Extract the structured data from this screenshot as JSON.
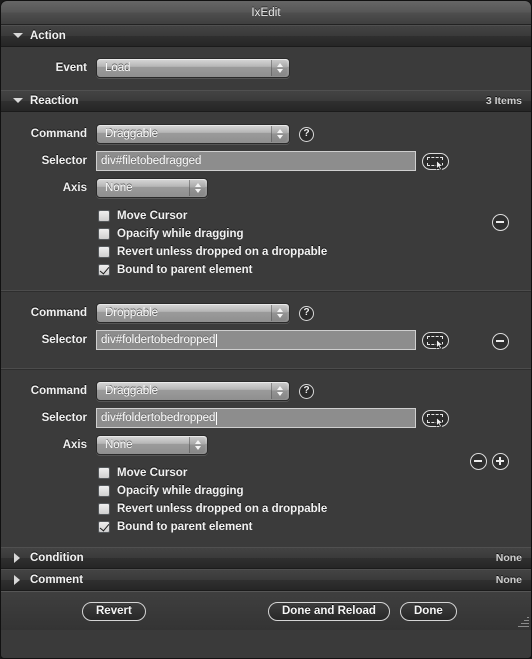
{
  "window": {
    "title": "IxEdit"
  },
  "sections": {
    "action": {
      "title": "Action",
      "disclosure": "triangle-down-icon",
      "event_label": "Event",
      "event_value": "Load"
    },
    "reaction": {
      "title": "Reaction",
      "disclosure": "triangle-down-icon",
      "count_label": "3 Items",
      "field_labels": {
        "command": "Command",
        "selector": "Selector",
        "axis": "Axis"
      },
      "help_glyph": "?",
      "items": [
        {
          "command": "Draggable",
          "selector": "div#filetobedragged",
          "selector_has_caret": false,
          "axis": "None",
          "has_axis": true,
          "options": [
            {
              "label": "Move Cursor",
              "checked": false
            },
            {
              "label": "Opacify while dragging",
              "checked": false
            },
            {
              "label": "Revert unless dropped on a droppable",
              "checked": false
            },
            {
              "label": "Bound to parent element",
              "checked": true
            }
          ],
          "buttons": [
            "minus"
          ]
        },
        {
          "command": "Droppable",
          "selector": "div#foldertobedropped",
          "selector_has_caret": true,
          "axis": "",
          "has_axis": false,
          "options": [],
          "buttons": [
            "minus"
          ]
        },
        {
          "command": "Draggable",
          "selector": "div#foldertobedropped",
          "selector_has_caret": true,
          "axis": "None",
          "has_axis": true,
          "options": [
            {
              "label": "Move Cursor",
              "checked": false
            },
            {
              "label": "Opacify while dragging",
              "checked": false
            },
            {
              "label": "Revert unless dropped on a droppable",
              "checked": false
            },
            {
              "label": "Bound to parent element",
              "checked": true
            }
          ],
          "buttons": [
            "minus",
            "plus"
          ]
        }
      ]
    },
    "condition": {
      "title": "Condition",
      "disclosure": "triangle-right-icon",
      "value": "None"
    },
    "comment": {
      "title": "Comment",
      "disclosure": "triangle-right-icon",
      "value": "None"
    }
  },
  "footer": {
    "revert_label": "Revert",
    "done_reload_label": "Done and Reload",
    "done_label": "Done",
    "resize_grip": "resize-grip-icon"
  }
}
